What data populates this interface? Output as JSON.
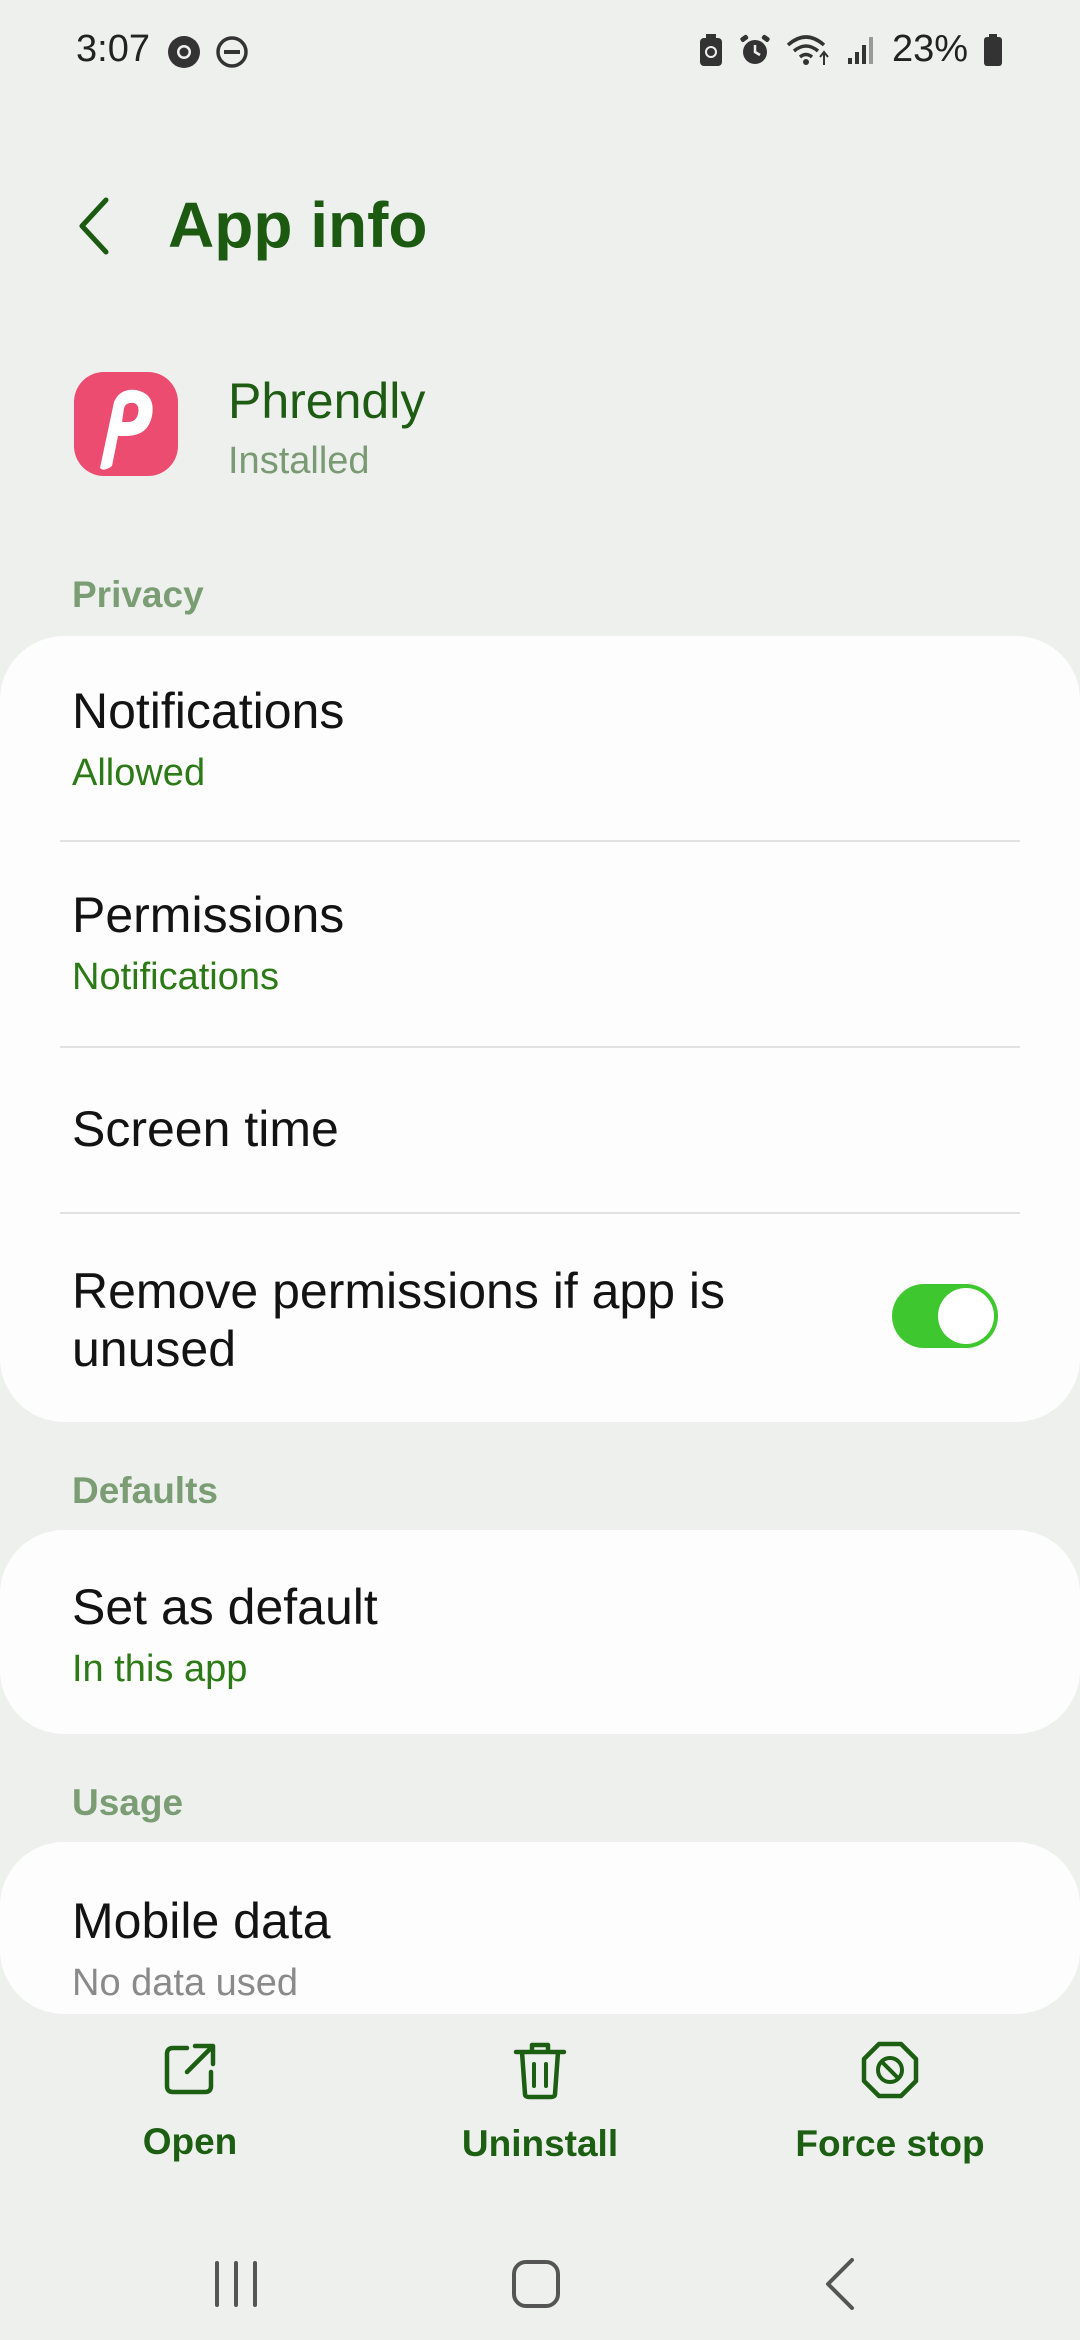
{
  "status_bar": {
    "time": "3:07",
    "battery": "23%"
  },
  "header": {
    "title": "App info"
  },
  "app": {
    "name": "Phrendly",
    "status": "Installed",
    "icon_letter": "p"
  },
  "sections": {
    "privacy": "Privacy",
    "defaults": "Defaults",
    "usage": "Usage"
  },
  "privacy_items": {
    "notifications": {
      "title": "Notifications",
      "subtitle": "Allowed"
    },
    "permissions": {
      "title": "Permissions",
      "subtitle": "Notifications"
    },
    "screen_time": {
      "title": "Screen time"
    },
    "remove_permissions": {
      "title": "Remove permissions if app is unused",
      "enabled": true
    }
  },
  "defaults_items": {
    "set_as_default": {
      "title": "Set as default",
      "subtitle": "In this app"
    }
  },
  "usage_items": {
    "mobile_data": {
      "title": "Mobile data",
      "subtitle": "No data used"
    }
  },
  "actions": {
    "open": "Open",
    "uninstall": "Uninstall",
    "force_stop": "Force stop"
  },
  "colors": {
    "accent": "#1c5e12",
    "toggle_on": "#3ec72e",
    "app_icon": "#ec4c6f",
    "background": "#eef0ee"
  }
}
